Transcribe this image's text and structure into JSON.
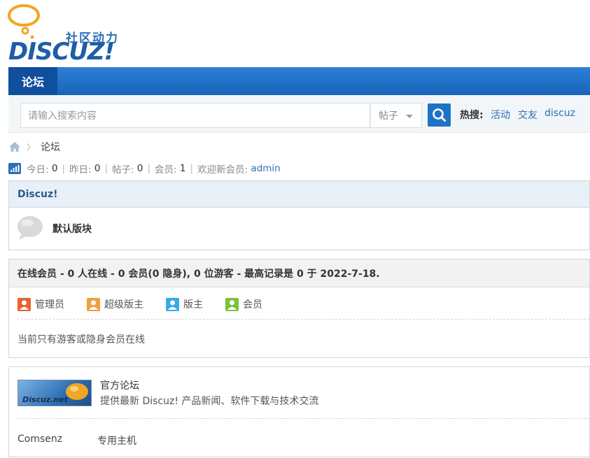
{
  "header": {
    "logo_sub": "社区动力",
    "logo_main": "DISCUZ!",
    "logo_icon": "speech-bubble-icon"
  },
  "nav": {
    "tab_label": "论坛"
  },
  "search": {
    "placeholder": "请输入搜索内容",
    "type_label": "帖子",
    "hot_label": "热搜:",
    "hot_links": [
      "活动",
      "交友",
      "discuz"
    ]
  },
  "breadcrumb": {
    "home_icon": "home-icon",
    "current": "论坛"
  },
  "stats": {
    "today_label": "今日:",
    "today_value": "0",
    "yesterday_label": "昨日:",
    "yesterday_value": "0",
    "posts_label": "帖子:",
    "posts_value": "0",
    "members_label": "会员:",
    "members_value": "1",
    "welcome_label": "欢迎新会员:",
    "welcome_user": "admin"
  },
  "category": {
    "title": "Discuz!",
    "forums": [
      {
        "name": "默认版块"
      }
    ]
  },
  "online": {
    "summary": "在线会员 - 0 人在线 - 0 会员(0 隐身), 0 位游客 - 最高记录是 0 于 2022-7-18.",
    "legend": [
      {
        "label": "管理员",
        "color": "#e8622c"
      },
      {
        "label": "超级版主",
        "color": "#f0a040"
      },
      {
        "label": "版主",
        "color": "#3aa7e6"
      },
      {
        "label": "会员",
        "color": "#7cc23a"
      }
    ],
    "status_text": "当前只有游客或隐身会员在线"
  },
  "links": {
    "image_link": {
      "badge_text": "Discuz.net",
      "title": "官方论坛",
      "desc": "提供最新 Discuz! 产品新闻、软件下载与技术交流"
    },
    "text_links": [
      "Comsenz",
      "专用主机"
    ]
  },
  "colors": {
    "nav_bg": "#1e6fc8",
    "accent": "#2b6fb6"
  }
}
